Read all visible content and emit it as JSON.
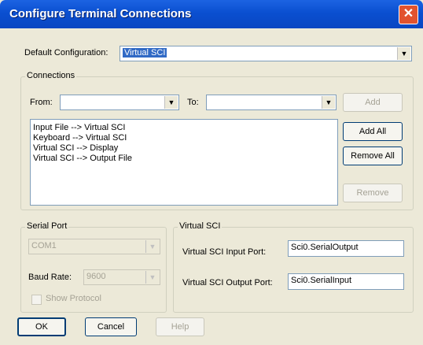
{
  "window": {
    "title": "Configure Terminal Connections",
    "close_glyph": "✕"
  },
  "default_config": {
    "label": "Default Configuration:",
    "value": "Virtual SCI"
  },
  "connections": {
    "group_label": "Connections",
    "from_label": "From:",
    "from_value": "",
    "to_label": "To:",
    "to_value": "",
    "add": "Add",
    "add_all": "Add All",
    "remove_all": "Remove All",
    "remove": "Remove",
    "items": [
      "Input File --> Virtual SCI",
      "Keyboard --> Virtual SCI",
      "Virtual SCI --> Display",
      "Virtual SCI --> Output File"
    ]
  },
  "serial_port": {
    "group_label": "Serial Port",
    "port_value": "COM1",
    "baud_label": "Baud Rate:",
    "baud_value": "9600",
    "show_protocol": "Show Protocol"
  },
  "virtual_sci": {
    "group_label": "Virtual SCI",
    "input_label": "Virtual SCI Input Port:",
    "input_value": "Sci0.SerialOutput",
    "output_label": "Virtual SCI Output Port:",
    "output_value": "Sci0.SerialInput"
  },
  "footer": {
    "ok": "OK",
    "cancel": "Cancel",
    "help": "Help"
  }
}
